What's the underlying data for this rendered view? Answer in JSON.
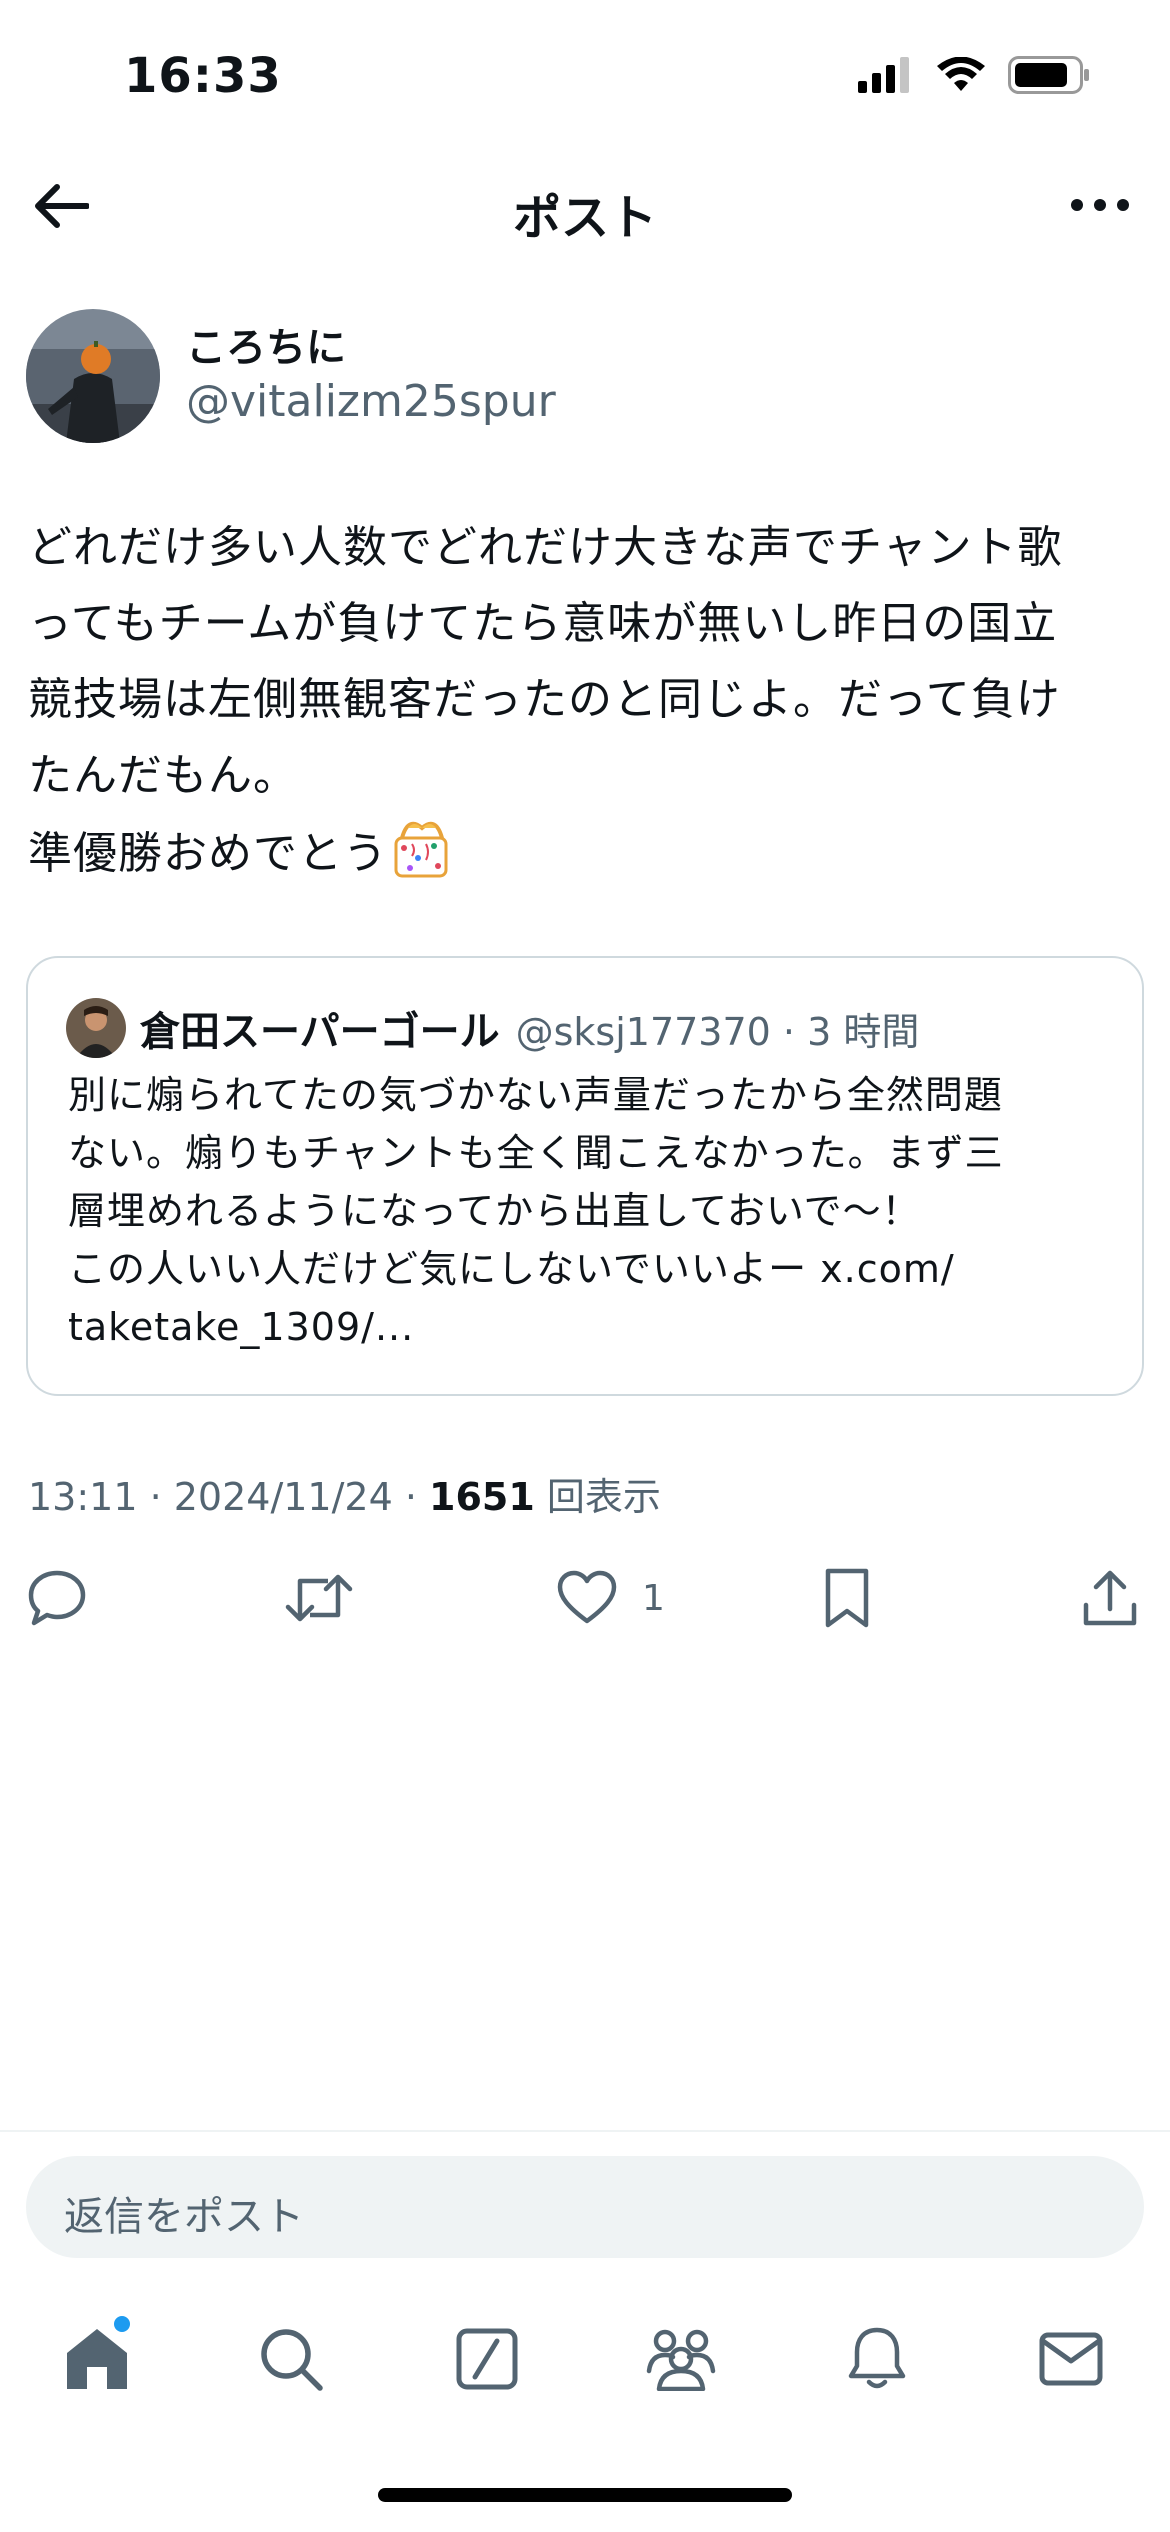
{
  "status_bar": {
    "time": "16:33"
  },
  "header": {
    "title": "ポスト"
  },
  "author": {
    "name": "ころちに",
    "handle": "@vitalizm25spur"
  },
  "tweet": {
    "text": "どれだけ多い人数でどれだけ大きな声でチャント歌\nってもチームが負けてたら意味が無いし昨日の国立\n競技場は左側無観客だったのと同じよ。だって負け\nたんだもん。\n準優勝おめでとう"
  },
  "quote": {
    "name": "倉田スーパーゴール",
    "handle": "@sksj177370 · 3 時間",
    "text": "別に煽られてたの気づかない声量だったから全然問題\nない。煽りもチャントも全く聞こえなかった。まず三\n層埋めれるようになってから出直しておいで〜！\nこの人いい人だけど気にしないでいいよー x.com/\ntaketake_1309/..."
  },
  "meta": {
    "datetime": "13:11 · 2024/11/24 · ",
    "views": "1651",
    "views_label": " 回表示"
  },
  "actions": {
    "like_count": "1"
  },
  "reply": {
    "placeholder": "返信をポスト"
  },
  "icons": [
    "back-arrow-icon",
    "more-icon",
    "reply-icon",
    "retweet-icon",
    "heart-icon",
    "bookmark-icon",
    "share-icon",
    "home-icon",
    "search-icon",
    "compose-icon",
    "communities-icon",
    "bell-icon",
    "mail-icon",
    "party-popper-icon"
  ],
  "colors": {
    "text": "#0f1419",
    "secondary": "#536471",
    "accent": "#1d9bf0",
    "border": "#cfd9de"
  }
}
